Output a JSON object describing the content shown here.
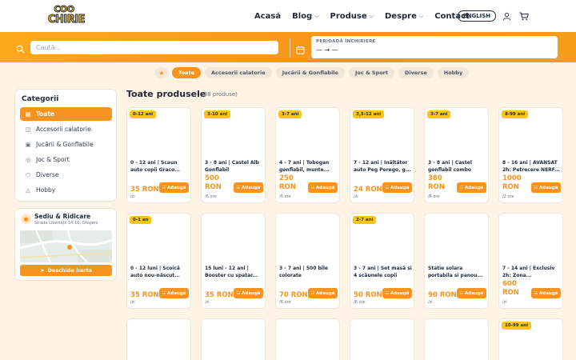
{
  "header": {
    "logo_line1": "COO",
    "logo_line2": "CHIRIE",
    "nav": [
      {
        "label": "Acasă",
        "dropdown": false
      },
      {
        "label": "Blog",
        "dropdown": true
      },
      {
        "label": "Produse",
        "dropdown": true
      },
      {
        "label": "Despre",
        "dropdown": true
      },
      {
        "label": "Contact",
        "dropdown": false
      }
    ],
    "language_button": "ENGLISH"
  },
  "search": {
    "placeholder": "Caută...",
    "period_label": "PERIOADĂ ÎNCHIRIERE",
    "period_value": "— → —"
  },
  "chips": [
    "Toate",
    "Accesorii calatorie",
    "Jucării & Gonflabile",
    "Joc & Sport",
    "Diverse",
    "Hobby"
  ],
  "sidebar": {
    "title": "Categorii",
    "items": [
      {
        "label": "Toate",
        "icon": "grid-icon",
        "active": true
      },
      {
        "label": "Accesorii calatorie",
        "icon": "car-icon",
        "active": false
      },
      {
        "label": "Jucării & Gonflabile",
        "icon": "puzzle-icon",
        "active": false
      },
      {
        "label": "Joc & Sport",
        "icon": "ball-icon",
        "active": false
      },
      {
        "label": "Diverse",
        "icon": "cube-icon",
        "active": false
      },
      {
        "label": "Hobby",
        "icon": "flask-icon",
        "active": false
      }
    ]
  },
  "location": {
    "title": "Sediu & Ridicare",
    "address": "Strada Libertății 14-16, Otopeni",
    "button": "Deschide harta"
  },
  "products_header": {
    "title": "Toate produsele",
    "count": "(38 produse)"
  },
  "add_label": "Adaugă",
  "products": [
    {
      "age": "0-12 ani",
      "name": "0 - 12 ani | Scaun auto copii Graco...",
      "price": "35 RON",
      "unit": "/zi"
    },
    {
      "age": "3-10 ani",
      "name": "3 - 8 ani | Castel Alb Gonflabil",
      "price": "500 RON",
      "unit": "/6 ore"
    },
    {
      "age": "3-7 ani",
      "name": "4 - 7 ani | Tobogan gonflabil, munte...",
      "price": "250 RON",
      "unit": "/6 ore"
    },
    {
      "age": "3,5-12 ani",
      "name": "7 - 12 ani | Înălțător auto Peg Perego, g...",
      "price": "24 RON",
      "unit": "/zi"
    },
    {
      "age": "3-7 ani",
      "name": "3 - 8 ani | Castel gonflabil combo",
      "price": "380 RON",
      "unit": "/6 ore"
    },
    {
      "age": "8-99 ani",
      "name": "8 - 16 ani | AVANSAT 2h: Petrecere NERF...",
      "price": "1000 RON",
      "unit": "/2 ore"
    },
    {
      "age": "0-1 an",
      "name": "0 - 12 luni | Scoică auto nou-născut...",
      "price": "35 RON",
      "unit": "/zi"
    },
    {
      "age": "",
      "name": "15 luni - 12 ani | Booster cu spatar...",
      "price": "35 RON",
      "unit": "/zi"
    },
    {
      "age": "",
      "name": "3 - 7 ani | 500 bile colorate",
      "price": "70 RON",
      "unit": "/6 ore"
    },
    {
      "age": "2-7 ani",
      "name": "3 - 7 ani | Set masă și 4 scăunele copii",
      "price": "50 RON",
      "unit": "/6 ore"
    },
    {
      "age": "",
      "name": "Statie solara portabila si panou...",
      "price": "90 RON",
      "unit": "/zi"
    },
    {
      "age": "",
      "name": "7 - 14 ani | Exclusiv 2h: Zona...",
      "price": "600 RON",
      "unit": "/zi"
    },
    {
      "age": "",
      "name": "",
      "price": "",
      "unit": ""
    },
    {
      "age": "",
      "name": "",
      "price": "",
      "unit": ""
    },
    {
      "age": "",
      "name": "",
      "price": "",
      "unit": ""
    },
    {
      "age": "",
      "name": "",
      "price": "",
      "unit": ""
    },
    {
      "age": "",
      "name": "",
      "price": "",
      "unit": ""
    },
    {
      "age": "10-99 ani",
      "name": "",
      "price": "",
      "unit": ""
    }
  ],
  "colors": {
    "accent": "#f7931e",
    "badge": "#fcc419",
    "background": "#fdf4e6"
  }
}
